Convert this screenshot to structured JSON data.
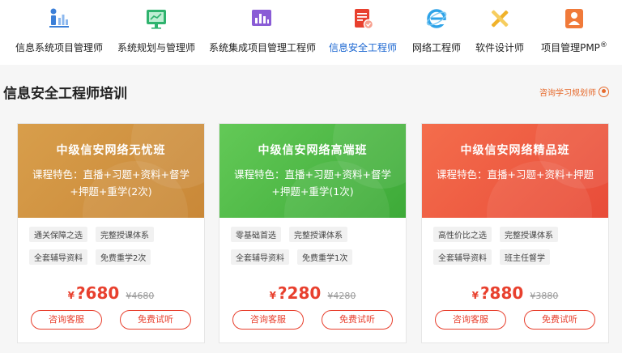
{
  "nav": {
    "items": [
      {
        "label": "信息系统项目管理师",
        "icon": "chart-person-icon",
        "color": "#3b7fd8"
      },
      {
        "label": "系统规划与管理师",
        "icon": "presentation-board-icon",
        "color": "#2fb36e"
      },
      {
        "label": "系统集成项目管理工程师",
        "icon": "bar-chart-icon",
        "color": "#8a5cd6"
      },
      {
        "label": "信息安全工程师",
        "icon": "secure-document-icon",
        "color": "#e8402e"
      },
      {
        "label": "网络工程师",
        "icon": "internet-explorer-icon",
        "color": "#2ea3e8"
      },
      {
        "label": "软件设计师",
        "icon": "cross-tools-icon",
        "color": "#f0b22a"
      },
      {
        "label": "项目管理PMP",
        "icon": "person-badge-icon",
        "color": "#f07a3a",
        "sup": "®"
      }
    ],
    "active_index": 3
  },
  "section": {
    "title": "信息安全工程师培训",
    "plan_link": "咨询学习规划师",
    "plan_icon": "consult-icon"
  },
  "cards": [
    {
      "title": "中级信安网络无忧班",
      "features": "课程特色：直播+习题+资料+督学+押题+重学(2次)",
      "gradient": [
        "#d79b48",
        "#c98a3a"
      ],
      "tags": [
        "通关保障之选",
        "完整授课体系",
        "全套辅导资料",
        "免费重学2次"
      ],
      "price_symbol": "¥",
      "price": "?680",
      "original_price": "¥4680",
      "consult_label": "咨询客服",
      "trial_label": "免费试听"
    },
    {
      "title": "中级信安网络高端班",
      "features": "课程特色：直播+习题+资料+督学+押题+重学(1次)",
      "gradient": [
        "#5fc653",
        "#3fae3a"
      ],
      "tags": [
        "零基础首选",
        "完整授课体系",
        "全套辅导资料",
        "免费重学1次"
      ],
      "price_symbol": "¥",
      "price": "?280",
      "original_price": "¥4280",
      "consult_label": "咨询客服",
      "trial_label": "免费试听"
    },
    {
      "title": "中级信安网络精品班",
      "features": "课程特色：直播+习题+资料+押题",
      "gradient": [
        "#f3694a",
        "#e9503c"
      ],
      "tags": [
        "高性价比之选",
        "完整授课体系",
        "全套辅导资料",
        "班主任督学"
      ],
      "price_symbol": "¥",
      "price": "?880",
      "original_price": "¥3880",
      "consult_label": "咨询客服",
      "trial_label": "免费试听"
    }
  ]
}
